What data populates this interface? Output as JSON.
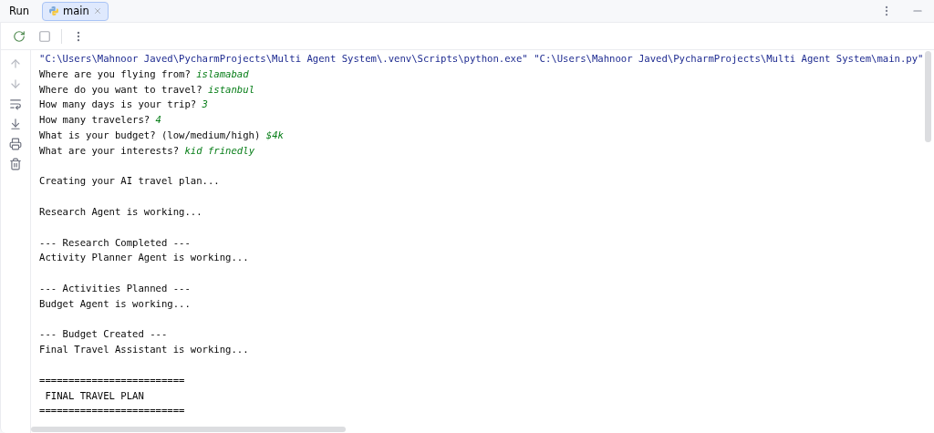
{
  "header": {
    "title": "Run",
    "tab": {
      "label": "main",
      "selected": true
    }
  },
  "console": {
    "lines": [
      {
        "kind": "command",
        "text": "\"C:\\Users\\Mahnoor Javed\\PycharmProjects\\Multi Agent System\\.venv\\Scripts\\python.exe\" \"C:\\Users\\Mahnoor Javed\\PycharmProjects\\Multi Agent System\\main.py\""
      },
      {
        "kind": "prompt",
        "text": "Where are you flying from?",
        "answer": "islamabad"
      },
      {
        "kind": "prompt",
        "text": "Where do you want to travel?",
        "answer": "istanbul"
      },
      {
        "kind": "prompt",
        "text": "How many days is your trip?",
        "answer": "3"
      },
      {
        "kind": "prompt",
        "text": "How many travelers?",
        "answer": "4"
      },
      {
        "kind": "prompt",
        "text": "What is your budget? (low/medium/high)",
        "answer": "$4k"
      },
      {
        "kind": "prompt",
        "text": "What are your interests?",
        "answer": "kid frinedly"
      },
      {
        "kind": "blank"
      },
      {
        "kind": "output",
        "text": "Creating your AI travel plan..."
      },
      {
        "kind": "blank"
      },
      {
        "kind": "output",
        "text": "Research Agent is working..."
      },
      {
        "kind": "blank"
      },
      {
        "kind": "output",
        "text": "--- Research Completed ---"
      },
      {
        "kind": "output",
        "text": "Activity Planner Agent is working..."
      },
      {
        "kind": "blank"
      },
      {
        "kind": "output",
        "text": "--- Activities Planned ---"
      },
      {
        "kind": "output",
        "text": "Budget Agent is working..."
      },
      {
        "kind": "blank"
      },
      {
        "kind": "output",
        "text": "--- Budget Created ---"
      },
      {
        "kind": "output",
        "text": "Final Travel Assistant is working..."
      },
      {
        "kind": "blank"
      },
      {
        "kind": "output",
        "text": "========================="
      },
      {
        "kind": "output",
        "text": " FINAL TRAVEL PLAN"
      },
      {
        "kind": "output",
        "text": "========================="
      }
    ]
  }
}
